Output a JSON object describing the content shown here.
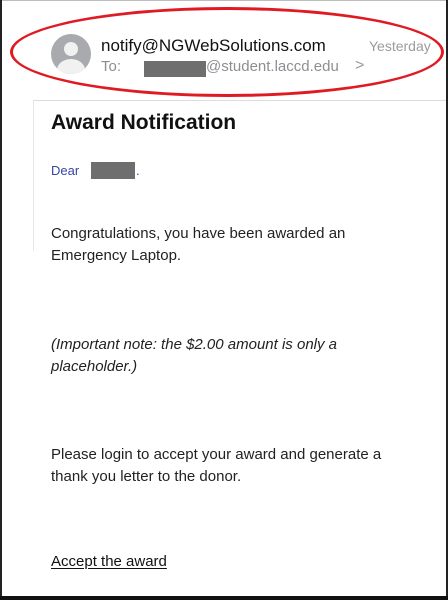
{
  "header": {
    "sender": "notify@NGWebSolutions.com",
    "timestamp": "Yesterday",
    "to_label": "To:",
    "to_domain": "@student.laccd.edu",
    "chevron": ">"
  },
  "message": {
    "title": "Award Notification",
    "greeting": "Dear",
    "greeting_punct": ".",
    "paragraphs": [
      "Congratulations, you have been awarded an Emergency Laptop.",
      "(Important note: the $2.00 amount is only a placeholder.)",
      "Please login to accept your award and generate a thank you letter to the donor."
    ],
    "link_label": "Accept the award"
  },
  "colors": {
    "annotation_ellipse": "#e01a22",
    "greeting_text": "#3a44a6",
    "redaction": "#6e6e6e"
  }
}
